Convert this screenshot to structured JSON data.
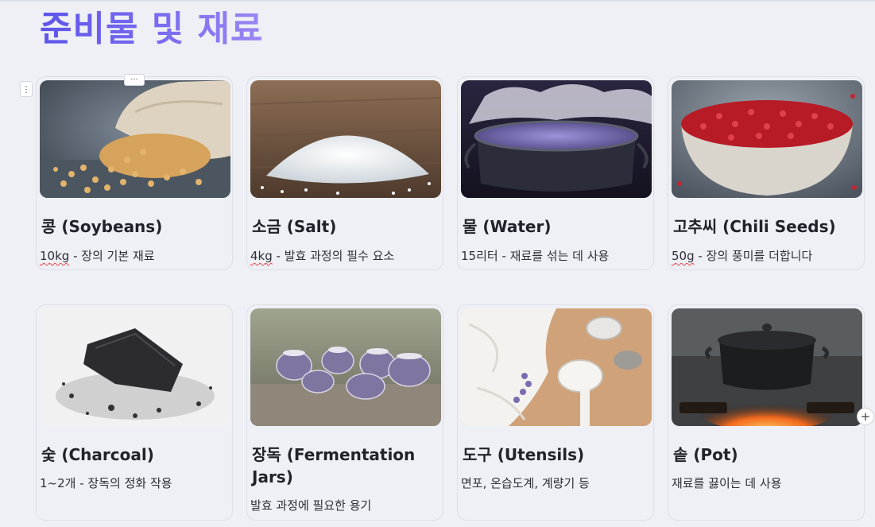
{
  "page": {
    "title": "준비물 및 재료",
    "side_handle_icon": "⋮",
    "top_handle_icon": "···",
    "add_icon": "+"
  },
  "cards": [
    {
      "name": "콩 (Soybeans)",
      "amount": "10kg",
      "desc": " - 장의 기본 재료",
      "image": "soybeans-in-burlap-sack"
    },
    {
      "name": "소금 (Salt)",
      "amount": "4kg",
      "desc": " - 발효 과정의 필수 요소",
      "image": "salt-pile"
    },
    {
      "name": "물 (Water)",
      "amount": "",
      "desc": "15리터 - 재료를 섞는 데 사용",
      "image": "steaming-pot-of-water"
    },
    {
      "name": "고추씨 (Chili Seeds)",
      "amount": "50g",
      "desc": " - 장의 풍미를 더합니다",
      "image": "bowl-of-chili-seeds"
    },
    {
      "name": "숯 (Charcoal)",
      "amount": "",
      "desc": "1~2개 - 장독의 정화 작용",
      "image": "charcoal-lump"
    },
    {
      "name": "장독 (Fermentation Jars)",
      "amount": "",
      "desc": "발효 과정에 필요한 용기",
      "image": "ceramic-jars"
    },
    {
      "name": "도구 (Utensils)",
      "amount": "",
      "desc": "면포, 온습도계, 계량기 등",
      "image": "cloth-and-measuring-spoons"
    },
    {
      "name": "솥 (Pot)",
      "amount": "",
      "desc": "재료를 끓이는 데 사용",
      "image": "pot-over-fire"
    }
  ]
}
